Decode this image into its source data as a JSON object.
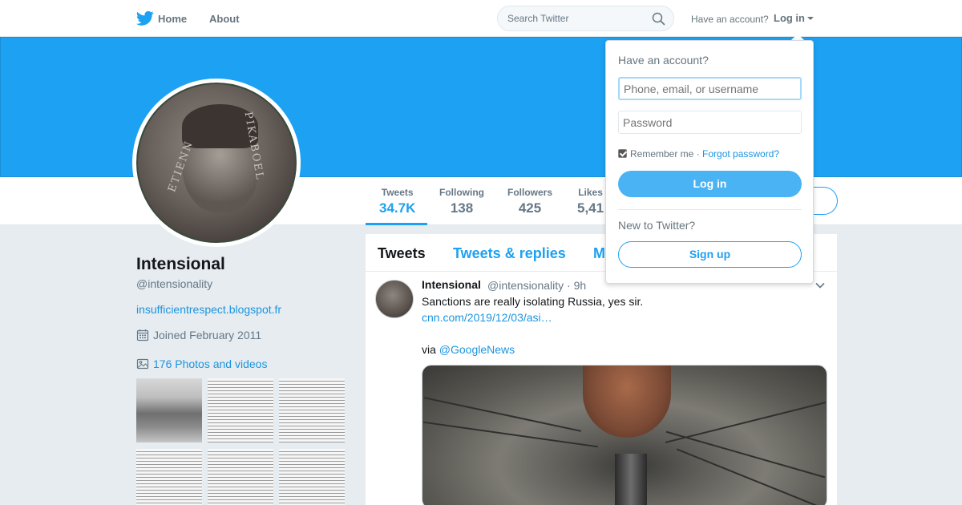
{
  "nav": {
    "home": "Home",
    "about": "About",
    "search_placeholder": "Search Twitter",
    "have_account": "Have an account?",
    "login": "Log in"
  },
  "profile": {
    "name": "Intensional",
    "handle": "@intensionality",
    "url": "insufficientrespect.blogspot.fr",
    "joined": "Joined February 2011",
    "photos": "176 Photos and videos",
    "avatar_lettering_left": "ETIENN",
    "avatar_lettering_right": "PIKABOEL"
  },
  "stats": [
    {
      "label": "Tweets",
      "value": "34.7K"
    },
    {
      "label": "Following",
      "value": "138"
    },
    {
      "label": "Followers",
      "value": "425"
    },
    {
      "label": "Likes",
      "value": "5,41"
    }
  ],
  "tabs": {
    "tweets": "Tweets",
    "replies": "Tweets & replies",
    "media": "M"
  },
  "tweet": {
    "name": "Intensional",
    "handle_time": "@intensionality · 9h",
    "text": "Sanctions are really isolating Russia, yes sir.",
    "link": "cnn.com/2019/12/03/asi…",
    "via": "via ",
    "mention": "@GoogleNews"
  },
  "login_dropdown": {
    "title": "Have an account?",
    "username_placeholder": "Phone, email, or username",
    "password_placeholder": "Password",
    "remember": "Remember me",
    "separator": " · ",
    "forgot": "Forgot password?",
    "login_button": "Log in",
    "new_to": "New to Twitter?",
    "signup_button": "Sign up"
  },
  "colors": {
    "brand": "#1da1f2",
    "link": "#1b95e0",
    "muted": "#657786"
  }
}
